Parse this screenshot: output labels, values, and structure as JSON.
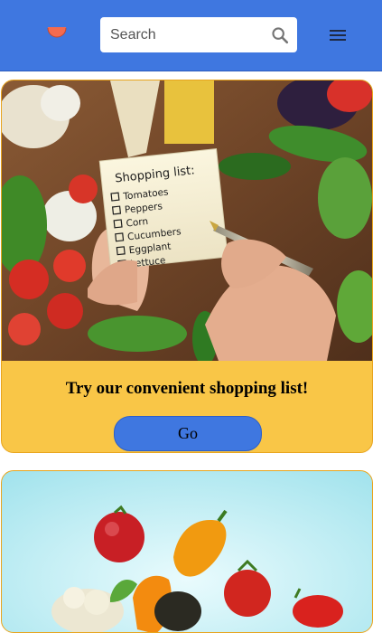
{
  "header": {
    "logo_icon": "tomato-logo-icon",
    "search": {
      "placeholder": "Search",
      "value": "",
      "icon": "search-icon"
    },
    "menu_icon": "hamburger-menu-icon"
  },
  "cards": [
    {
      "image": "shopping-list-hand-vegetables-photo",
      "note_heading": "Shopping list:",
      "note_items": [
        "Tomatoes",
        "Peppers",
        "Corn",
        "Cucumbers",
        "Eggplant",
        "Lettuce"
      ],
      "title": "Try our convenient shopping list!",
      "button_label": "Go"
    },
    {
      "image": "falling-vegetables-photo"
    }
  ],
  "colors": {
    "header_bg": "#3f77e0",
    "card_bg": "#f9c647",
    "card_border": "#e8a41d",
    "button_bg": "#3f77e0"
  }
}
